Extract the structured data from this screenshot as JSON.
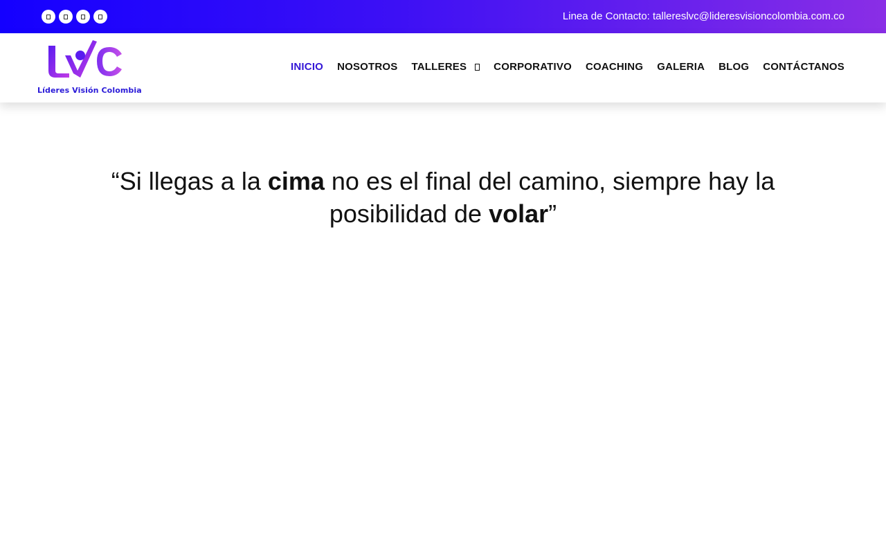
{
  "topbar": {
    "social_icons": [
      "facebook-icon",
      "instagram-icon",
      "youtube-icon",
      "whatsapp-icon"
    ],
    "contact_text": "Linea de Contacto: tallereslvc@lideresvisioncolombia.com.co"
  },
  "header": {
    "logo": {
      "mark": "LVC",
      "name": "Líderes Visión Colombia"
    },
    "nav": [
      {
        "label": "INICIO",
        "active": true
      },
      {
        "label": "NOSOTROS"
      },
      {
        "label": "TALLERES",
        "dropdown": true
      },
      {
        "label": "CORPORATIVO"
      },
      {
        "label": "COACHING"
      },
      {
        "label": "GALERIA"
      },
      {
        "label": "BLOG"
      },
      {
        "label": "CONTÁCTANOS"
      }
    ]
  },
  "quote": {
    "part1": "“Si llegas a la ",
    "bold1": "cima",
    "part2": " no es el final del camino, siempre hay la posibilidad de ",
    "bold2": "volar",
    "part3": "”"
  },
  "colors": {
    "topbar_gradient_start": "#1400ff",
    "topbar_gradient_end": "#8a2ee6",
    "nav_active": "#3316d6",
    "logo_text": "#2a1ad8"
  }
}
